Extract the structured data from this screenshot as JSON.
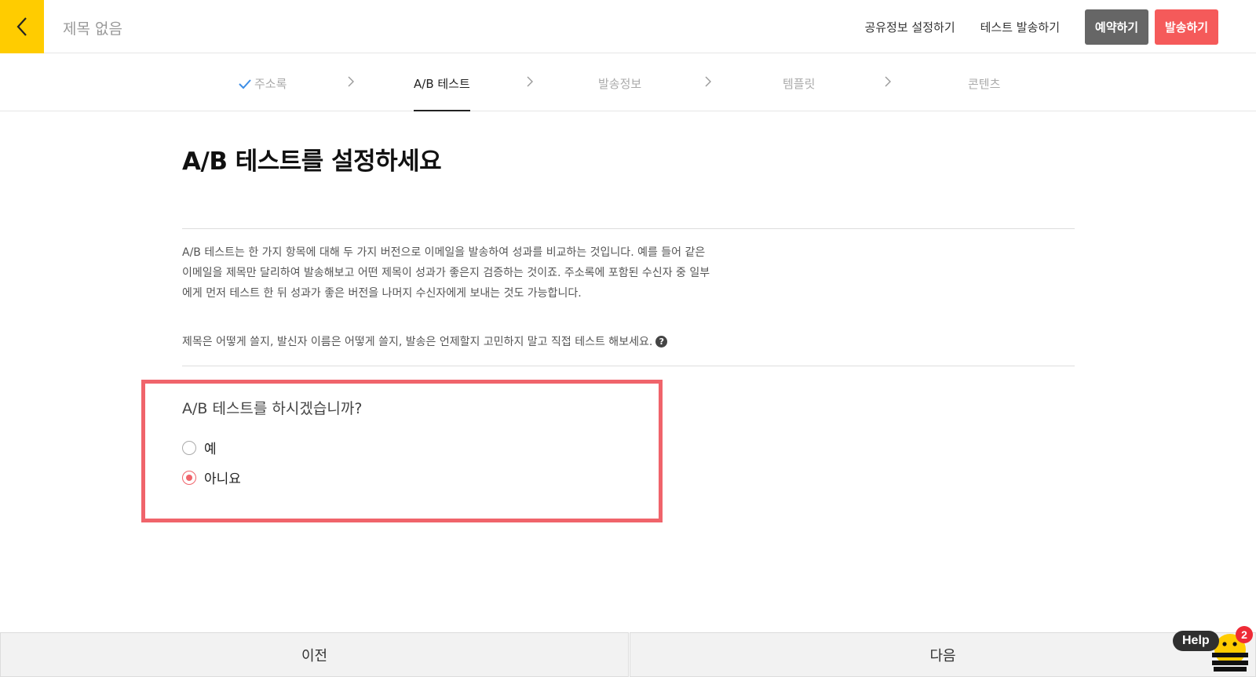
{
  "header": {
    "title": "제목 없음",
    "actions": {
      "shared_info": "공유정보 설정하기",
      "test_send": "테스트 발송하기",
      "reserve": "예약하기",
      "send": "발송하기"
    }
  },
  "steps": [
    {
      "label": "주소록",
      "state": "done"
    },
    {
      "label": "A/B 테스트",
      "state": "active"
    },
    {
      "label": "발송정보",
      "state": "pending"
    },
    {
      "label": "템플릿",
      "state": "pending"
    },
    {
      "label": "콘텐츠",
      "state": "pending"
    }
  ],
  "main": {
    "title": "A/B 테스트를 설정하세요",
    "description_lines": [
      "A/B 테스트는 한 가지 항목에 대해 두 가지 버전으로 이메일을 발송하여 성과를 비교하는 것입니다. 예를 들어 같은",
      "이메일을 제목만 달리하여 발송해보고 어떤 제목이 성과가 좋은지 검증하는 것이죠. 주소록에 포함된 수신자 중 일부",
      "에게 먼저 테스트 한 뒤 성과가 좋은 버전을 나머지 수신자에게 보내는 것도 가능합니다."
    ],
    "tip": "제목은 어떻게 쓸지, 발신자 이름은 어떻게 쓸지, 발송은 언제할지 고민하지 말고 직접 테스트 해보세요.",
    "tip_icon": "?",
    "question": "A/B 테스트를 하시겠습니까?",
    "options": [
      {
        "label": "예",
        "checked": false
      },
      {
        "label": "아니요",
        "checked": true
      }
    ]
  },
  "footer": {
    "prev": "이전",
    "next": "다음"
  },
  "help": {
    "label": "Help",
    "badge": "2"
  },
  "colors": {
    "brand_yellow": "#ffcc00",
    "accent_red": "#f55a5a",
    "highlight_border": "#f0646b",
    "dark_button": "#666666"
  },
  "icons": {
    "back": "chevron-left-icon",
    "step_done": "check-icon",
    "step_separator": "chevron-right-icon",
    "help": "help-bee-icon"
  }
}
